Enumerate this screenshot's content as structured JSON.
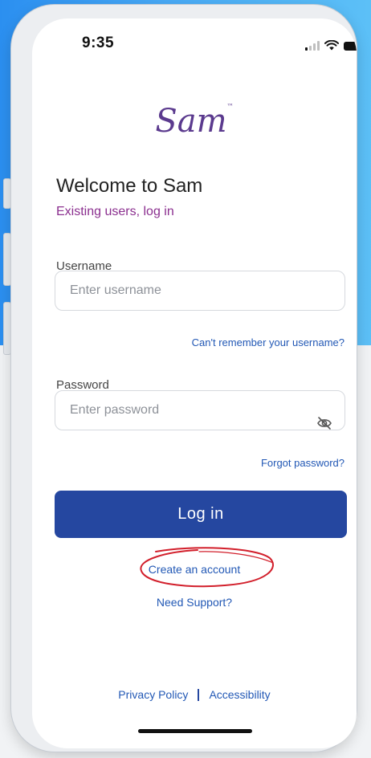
{
  "status_bar": {
    "time": "9:35",
    "signal_icon": "cellular-signal-icon",
    "wifi_icon": "wifi-icon",
    "battery_icon": "battery-icon"
  },
  "logo": {
    "text": "Sam",
    "mark": "™"
  },
  "welcome": {
    "title": "Welcome to Sam",
    "subtitle": "Existing users, log in"
  },
  "username": {
    "label": "Username",
    "placeholder": "Enter username",
    "value": "",
    "forgot_link": "Can't remember your username?"
  },
  "password": {
    "label": "Password",
    "placeholder": "Enter password",
    "value": "",
    "visibility_icon": "eye-slash-icon",
    "forgot_link": "Forgot password?"
  },
  "login_button": "Log in",
  "create_account": "Create an account",
  "need_support": "Need Support?",
  "footer": {
    "privacy": "Privacy Policy",
    "separator": "|",
    "accessibility": "Accessibility"
  },
  "colors": {
    "primary": "#2547a0",
    "link": "#2258b5",
    "brand": "#8b2f8f",
    "annotation": "#d21f2b"
  }
}
